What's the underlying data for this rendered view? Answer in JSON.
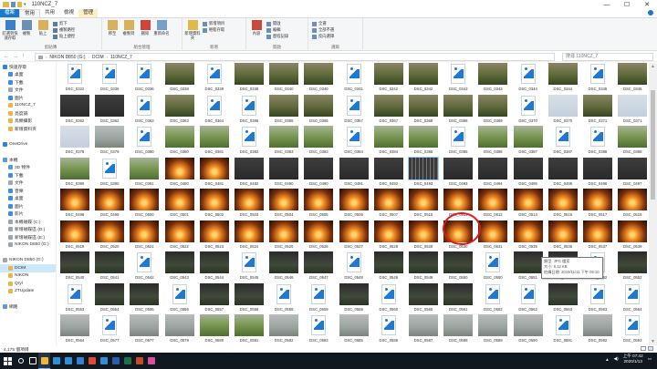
{
  "window": {
    "title": "110NCZ_7",
    "controls": [
      "—",
      "☐",
      "✕"
    ]
  },
  "tabs": [
    {
      "label": "檔案",
      "kind": "file"
    },
    {
      "label": "常用",
      "kind": "active"
    },
    {
      "label": "共用",
      "kind": "normal"
    },
    {
      "label": "檢視",
      "kind": "normal"
    },
    {
      "label": "管理",
      "kind": "manage"
    }
  ],
  "ribbon": {
    "groups": [
      {
        "name": "剪貼簿",
        "big": [
          {
            "label": "釘選到快速存取",
            "color": "#3b7fd0"
          },
          {
            "label": "複製",
            "color": "#6a8fb8"
          },
          {
            "label": "貼上",
            "color": "#d9b15b"
          }
        ],
        "small": [
          {
            "label": "剪下",
            "color": "#5a7ea6"
          },
          {
            "label": "複製路徑",
            "color": "#5a7ea6"
          },
          {
            "label": "貼上捷徑",
            "color": "#5a7ea6"
          }
        ]
      },
      {
        "name": "組合管理",
        "big": [
          {
            "label": "移至",
            "color": "#d9b15b"
          },
          {
            "label": "複製到",
            "color": "#d9b15b"
          },
          {
            "label": "刪除",
            "color": "#d0453a"
          },
          {
            "label": "重新命名",
            "color": "#7a9fc6"
          }
        ],
        "small": []
      },
      {
        "name": "新增",
        "big": [
          {
            "label": "新增資料夾",
            "color": "#e2b84a"
          }
        ],
        "small": [
          {
            "label": "新增項目",
            "color": "#6a8fb8"
          },
          {
            "label": "輕鬆存取",
            "color": "#6a8fb8"
          }
        ]
      },
      {
        "name": "開啟",
        "big": [
          {
            "label": "內容",
            "color": "#c94a3d"
          }
        ],
        "small": [
          {
            "label": "開啟",
            "color": "#6a8fb8"
          },
          {
            "label": "編輯",
            "color": "#6a8fb8"
          },
          {
            "label": "歷程記錄",
            "color": "#6a8fb8"
          }
        ]
      },
      {
        "name": "選取",
        "big": [],
        "small": [
          {
            "label": "全選",
            "color": "#6a8fb8"
          },
          {
            "label": "全部不選",
            "color": "#6a8fb8"
          },
          {
            "label": "反向選擇",
            "color": "#6a8fb8"
          }
        ]
      }
    ]
  },
  "address": {
    "crumbs": [
      "NIKON D850 (G:)",
      "DCIM",
      "110NCZ_7"
    ],
    "search_placeholder": "搜尋 110NCZ_7"
  },
  "nav": [
    {
      "label": "快速存取",
      "color": "#2b88d8",
      "indent": 1,
      "selected": false
    },
    {
      "label": "桌面",
      "color": "#3a8ee6",
      "indent": 3,
      "selected": false
    },
    {
      "label": "下載",
      "color": "#3a8ee6",
      "indent": 3,
      "selected": false
    },
    {
      "label": "文件",
      "color": "#9aa7b4",
      "indent": 3,
      "selected": false
    },
    {
      "label": "圖片",
      "color": "#3a8ee6",
      "indent": 3,
      "selected": false
    },
    {
      "label": "110NCZ_7",
      "color": "#e2b84a",
      "indent": 3,
      "selected": false
    },
    {
      "label": "亮度調",
      "color": "#e2b84a",
      "indent": 3,
      "selected": false
    },
    {
      "label": "鳥類攝影",
      "color": "#e2b84a",
      "indent": 3,
      "selected": false
    },
    {
      "label": "新增資料夾",
      "color": "#e2b84a",
      "indent": 3,
      "selected": false
    },
    {
      "label": "",
      "color": "transparent",
      "indent": 1,
      "selected": false
    },
    {
      "label": "OneDrive",
      "color": "#2b88d8",
      "indent": 1,
      "selected": false
    },
    {
      "label": "",
      "color": "transparent",
      "indent": 1,
      "selected": false
    },
    {
      "label": "本機",
      "color": "#5a9bd5",
      "indent": 1,
      "selected": false
    },
    {
      "label": "3D 物件",
      "color": "#5a9bd5",
      "indent": 3,
      "selected": false
    },
    {
      "label": "下載",
      "color": "#3a8ee6",
      "indent": 3,
      "selected": false
    },
    {
      "label": "文件",
      "color": "#9aa7b4",
      "indent": 3,
      "selected": false
    },
    {
      "label": "音樂",
      "color": "#3a8ee6",
      "indent": 3,
      "selected": false
    },
    {
      "label": "桌面",
      "color": "#3a8ee6",
      "indent": 3,
      "selected": false
    },
    {
      "label": "圖片",
      "color": "#3a8ee6",
      "indent": 3,
      "selected": false
    },
    {
      "label": "影片",
      "color": "#3a8ee6",
      "indent": 3,
      "selected": false
    },
    {
      "label": "本機磁碟 (C:)",
      "color": "#9aa7b4",
      "indent": 3,
      "selected": false
    },
    {
      "label": "新增磁碟區 (D:)",
      "color": "#9aa7b4",
      "indent": 3,
      "selected": false
    },
    {
      "label": "新增磁碟區 (E:)",
      "color": "#9aa7b4",
      "indent": 3,
      "selected": false
    },
    {
      "label": "NIKON D850 (G:)",
      "color": "#9aa7b4",
      "indent": 3,
      "selected": false
    },
    {
      "label": "",
      "color": "transparent",
      "indent": 1,
      "selected": false
    },
    {
      "label": "NIKON D850 (G:)",
      "color": "#9aa7b4",
      "indent": 1,
      "selected": false
    },
    {
      "label": "DCIM",
      "color": "#e2b84a",
      "indent": 3,
      "selected": true
    },
    {
      "label": "NIKON",
      "color": "#e2b84a",
      "indent": 3,
      "selected": false
    },
    {
      "label": "Qryl",
      "color": "#e2b84a",
      "indent": 3,
      "selected": false
    },
    {
      "label": "ZTUpdate",
      "color": "#e2b84a",
      "indent": 3,
      "selected": false
    },
    {
      "label": "",
      "color": "transparent",
      "indent": 1,
      "selected": false
    },
    {
      "label": "網路",
      "color": "#5a9bd5",
      "indent": 1,
      "selected": false
    }
  ],
  "grid": {
    "rows": [
      {
        "items": [
          [
            "DSC_0322",
            "icon"
          ],
          [
            "DSC_0336",
            "icon"
          ],
          [
            "DSC_0336",
            "icon"
          ],
          [
            "DSC_0338",
            "field"
          ],
          [
            "DSC_0339",
            "icon"
          ],
          [
            "DSC_0339",
            "field"
          ],
          [
            "DSC_0340",
            "field"
          ],
          [
            "DSC_0340",
            "field"
          ],
          [
            "DSC_0341",
            "icon"
          ],
          [
            "DSC_0342",
            "field"
          ],
          [
            "DSC_0342",
            "field"
          ],
          [
            "DSC_0343",
            "icon"
          ],
          [
            "DSC_0343",
            "field"
          ],
          [
            "DSC_0344",
            "icon"
          ],
          [
            "DSC_0344",
            "field"
          ],
          [
            "DSC_0345",
            "icon"
          ],
          [
            "DSC_0345",
            "field"
          ]
        ]
      },
      {
        "items": [
          [
            "DSC_0362",
            "dark"
          ],
          [
            "DSC_0362",
            "dark"
          ],
          [
            "DSC_0363",
            "icon"
          ],
          [
            "DSC_0363",
            "field"
          ],
          [
            "DSC_0364",
            "icon"
          ],
          [
            "DSC_0365",
            "icon"
          ],
          [
            "DSC_0365",
            "field"
          ],
          [
            "DSC_0366",
            "field"
          ],
          [
            "DSC_0367",
            "icon"
          ],
          [
            "DSC_0367",
            "field"
          ],
          [
            "DSC_0368",
            "field"
          ],
          [
            "DSC_0368",
            "field"
          ],
          [
            "DSC_0369",
            "field"
          ],
          [
            "DSC_0370",
            "icon"
          ],
          [
            "DSC_0370",
            "sky"
          ],
          [
            "DSC_0371",
            "field"
          ],
          [
            "DSC_0371",
            "sky"
          ]
        ]
      },
      {
        "items": [
          [
            "DSC_0378",
            "sky"
          ],
          [
            "DSC_0379",
            "bird"
          ],
          [
            "DSC_0380",
            "icon"
          ],
          [
            "DSC_0380",
            "grass"
          ],
          [
            "DSC_0381",
            "grass"
          ],
          [
            "DSC_0382",
            "icon"
          ],
          [
            "DSC_0383",
            "grass"
          ],
          [
            "DSC_0383",
            "grass"
          ],
          [
            "DSC_0384",
            "icon"
          ],
          [
            "DSC_0384",
            "grass"
          ],
          [
            "DSC_0385",
            "grass"
          ],
          [
            "DSC_0385",
            "icon"
          ],
          [
            "DSC_0386",
            "grass"
          ],
          [
            "DSC_0387",
            "grass"
          ],
          [
            "DSC_0387",
            "icon"
          ],
          [
            "DSC_0388",
            "icon"
          ],
          [
            "DSC_0388",
            "grass"
          ]
        ]
      },
      {
        "items": [
          [
            "DSC_0390",
            "grass"
          ],
          [
            "DSC_0390",
            "icon"
          ],
          [
            "DSC_0391",
            "grass"
          ],
          [
            "DSC_0480",
            "sunset"
          ],
          [
            "DSC_0481",
            "sunset"
          ],
          [
            "DSC_0482",
            "dark"
          ],
          [
            "DSC_0490",
            "dark"
          ],
          [
            "DSC_0490",
            "dark"
          ],
          [
            "DSC_0491",
            "dark"
          ],
          [
            "DSC_0492",
            "dark"
          ],
          [
            "DSC_0493",
            "film"
          ],
          [
            "DSC_0493",
            "dark"
          ],
          [
            "DSC_0494",
            "dark"
          ],
          [
            "DSC_0495",
            "dark"
          ],
          [
            "DSC_0495",
            "dark"
          ],
          [
            "DSC_0496",
            "dark"
          ],
          [
            "DSC_0497",
            "dark"
          ]
        ]
      },
      {
        "items": [
          [
            "DSC_0498",
            "sunset"
          ],
          [
            "DSC_0499",
            "sunset"
          ],
          [
            "DSC_0500",
            "sunset"
          ],
          [
            "DSC_0501",
            "sunset"
          ],
          [
            "DSC_0502",
            "sunset"
          ],
          [
            "DSC_0503",
            "sunset"
          ],
          [
            "DSC_0504",
            "sunset"
          ],
          [
            "DSC_0505",
            "sunset"
          ],
          [
            "DSC_0506",
            "sunset"
          ],
          [
            "DSC_0507",
            "sunset"
          ],
          [
            "DSC_0510",
            "sunset"
          ],
          [
            "DSC_0511",
            "sunset"
          ],
          [
            "DSC_0512",
            "sunset"
          ],
          [
            "DSC_0514",
            "sunset"
          ],
          [
            "DSC_0516",
            "sunset"
          ],
          [
            "DSC_0517",
            "sunset"
          ],
          [
            "DSC_0518",
            "sunset"
          ]
        ]
      },
      {
        "items": [
          [
            "DSC_0519",
            "sunset"
          ],
          [
            "DSC_0520",
            "sunset"
          ],
          [
            "DSC_0521",
            "sunset"
          ],
          [
            "DSC_0522",
            "sunset"
          ],
          [
            "DSC_0523",
            "sunset"
          ],
          [
            "DSC_0524",
            "sunset"
          ],
          [
            "DSC_0525",
            "sunset"
          ],
          [
            "DSC_0526",
            "sunset"
          ],
          [
            "DSC_0527",
            "sunset"
          ],
          [
            "DSC_0528",
            "sunset"
          ],
          [
            "DSC_0529",
            "sunset"
          ],
          [
            "DSC_0530",
            "sunset"
          ],
          [
            "DSC_0531",
            "sunset"
          ],
          [
            "DSC_0535",
            "sunset"
          ],
          [
            "DSC_0536",
            "sunset"
          ],
          [
            "DSC_0537",
            "sunset"
          ],
          [
            "DSC_0539",
            "sunset"
          ]
        ]
      },
      {
        "items": [
          [
            "DSC_0540",
            "dusk"
          ],
          [
            "DSC_0541",
            "dusk"
          ],
          [
            "DSC_0542",
            "icon"
          ],
          [
            "DSC_0543",
            "dusk"
          ],
          [
            "DSC_0544",
            "dusk"
          ],
          [
            "DSC_0545",
            "icon"
          ],
          [
            "DSC_0546",
            "dusk"
          ],
          [
            "DSC_0547",
            "dusk"
          ],
          [
            "DSC_0548",
            "icon"
          ],
          [
            "DSC_0549",
            "dusk"
          ],
          [
            "DSC_0549",
            "dusk"
          ],
          [
            "DSC_0550",
            "dusk"
          ],
          [
            "DSC_0550",
            "icon"
          ],
          [
            "DSC_0551",
            "dusk"
          ],
          [
            "DSC_0551",
            "dusk"
          ],
          [
            "DSC_0552",
            "icon"
          ],
          [
            "DSC_0552",
            "dusk"
          ]
        ]
      },
      {
        "items": [
          [
            "DSC_0553",
            "icon"
          ],
          [
            "DSC_0554",
            "dusk"
          ],
          [
            "DSC_0555",
            "dusk"
          ],
          [
            "DSC_0556",
            "icon"
          ],
          [
            "DSC_0557",
            "dusk"
          ],
          [
            "DSC_0558",
            "dusk"
          ],
          [
            "DSC_0558",
            "icon"
          ],
          [
            "DSC_0559",
            "icon"
          ],
          [
            "DSC_0559",
            "dusk"
          ],
          [
            "DSC_0560",
            "icon"
          ],
          [
            "DSC_0560",
            "dusk"
          ],
          [
            "DSC_0561",
            "dusk"
          ],
          [
            "DSC_0562",
            "icon"
          ],
          [
            "DSC_0562",
            "icon"
          ],
          [
            "DSC_0563",
            "dusk"
          ],
          [
            "DSC_0563",
            "icon"
          ],
          [
            "DSC_0564",
            "icon"
          ]
        ]
      },
      {
        "items": [
          [
            "DSC_0564",
            "bird"
          ],
          [
            "DSC_0577",
            "icon"
          ],
          [
            "DSC_0577",
            "bird"
          ],
          [
            "DSC_0578",
            "bird"
          ],
          [
            "DSC_0580",
            "grass"
          ],
          [
            "DSC_0581",
            "grass"
          ],
          [
            "DSC_0582",
            "bird"
          ],
          [
            "DSC_0583",
            "icon"
          ],
          [
            "DSC_0585",
            "bird"
          ],
          [
            "DSC_0586",
            "icon"
          ],
          [
            "DSC_0587",
            "bird"
          ],
          [
            "DSC_0588",
            "bird"
          ],
          [
            "DSC_0589",
            "bird"
          ],
          [
            "DSC_0590",
            "bird"
          ],
          [
            "DSC_0591",
            "icon"
          ],
          [
            "DSC_0592",
            "bird"
          ],
          [
            "DSC_0593",
            "icon"
          ]
        ]
      },
      {
        "items": [
          [
            "DSC_0650",
            "bird"
          ],
          [
            "DSC_0653",
            "bird"
          ],
          [
            "DSC_0654",
            "bird"
          ],
          [
            "DSC_0655",
            "icon"
          ],
          [
            "DSC_0657",
            "bird"
          ],
          [
            "DSC_0658",
            "bird"
          ],
          [
            "DSC_0659",
            "bird"
          ],
          [
            "DSC_0660",
            "bird"
          ],
          [
            "DSC_0661",
            "bird"
          ],
          [
            "DSC_0672",
            "bird"
          ],
          [
            "DSC_0674",
            "bird"
          ],
          [
            "DSC_0675",
            "bird"
          ],
          [
            "DSC_0676",
            "bird"
          ],
          [
            "DSC_0677",
            "bird"
          ],
          [
            "DSC_0678",
            "bird"
          ],
          [
            "DSC_0679",
            "bird"
          ],
          [
            "DSC_0680",
            "bird"
          ]
        ]
      }
    ]
  },
  "tooltip": {
    "line1": "類型: JPG 檔案",
    "line2": "大小: 6.12 KB",
    "line3": "拍攝日期: 2019/11/11 下午 05:10"
  },
  "status": {
    "count": "4,175 個項目"
  },
  "taskbar": {
    "apps": [
      {
        "name": "search",
        "color": "#ffffff"
      },
      {
        "name": "task-view",
        "color": "#ffffff"
      },
      {
        "name": "explorer",
        "color": "#e8b93b",
        "active": true
      },
      {
        "name": "edge",
        "color": "#2f8fd8"
      },
      {
        "name": "store",
        "color": "#2f8fd8"
      },
      {
        "name": "mail",
        "color": "#3a7fd0"
      },
      {
        "name": "chrome",
        "color": "#e3493b"
      },
      {
        "name": "photos",
        "color": "#2f8fd8"
      },
      {
        "name": "word",
        "color": "#2b5ea8"
      },
      {
        "name": "excel",
        "color": "#1e7145"
      },
      {
        "name": "powerpoint",
        "color": "#c54b2a"
      },
      {
        "name": "paint",
        "color": "#d94f9f"
      }
    ],
    "time": "上午 07:42",
    "date": "2020/1/13"
  }
}
